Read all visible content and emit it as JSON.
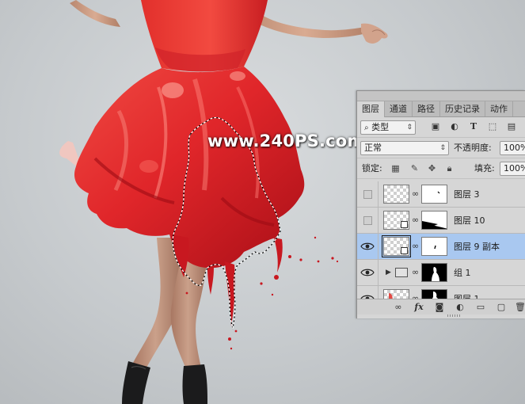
{
  "watermark": "www.240PS.com",
  "panel": {
    "tabs": [
      "图层",
      "通道",
      "路径",
      "历史记录",
      "动作"
    ],
    "active_tab": "图层",
    "filter_icon": "search-icon",
    "filter_kind": "类型",
    "blend_mode": "正常",
    "opacity_label": "不透明度:",
    "opacity_value": "100%",
    "lock_label": "锁定:",
    "fill_label": "填充:",
    "fill_value": "100%",
    "layers": [
      {
        "name": "图层 3",
        "visible": false,
        "selected": false
      },
      {
        "name": "图层 10",
        "visible": false,
        "selected": false
      },
      {
        "name": "图层 9 副本",
        "visible": true,
        "selected": true
      },
      {
        "name": "组 1",
        "visible": true,
        "selected": false
      },
      {
        "name": "图层 1",
        "visible": true,
        "selected": false
      }
    ],
    "bottom_icons": [
      "link-icon",
      "fx-icon",
      "add-mask-icon",
      "adjustment-icon",
      "new-group-icon",
      "new-layer-icon",
      "delete-icon"
    ],
    "bottom_fx_label": "fx"
  },
  "colors": {
    "dress": "#e52a28",
    "dress_dark": "#b8141a",
    "panel_bg": "#d6d6d6",
    "selection_highlight": "#a9c8f0"
  }
}
